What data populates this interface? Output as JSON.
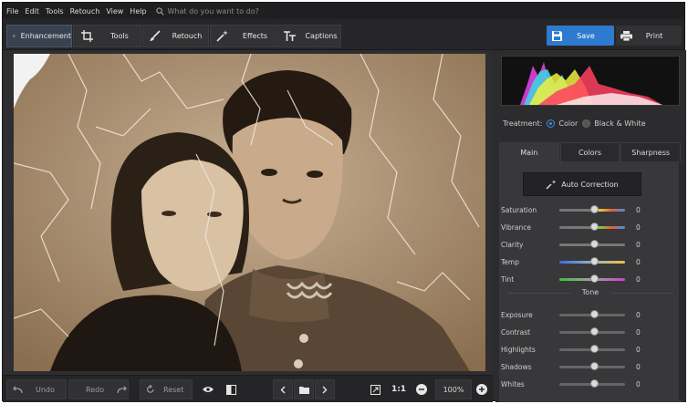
{
  "menu": {
    "items": [
      "File",
      "Edit",
      "Tools",
      "Retouch",
      "View",
      "Help"
    ],
    "search_placeholder": "What do you want to do?"
  },
  "toolbar": {
    "tabs": [
      {
        "label": "Enhancement",
        "icon": "sliders-icon"
      },
      {
        "label": "Tools",
        "icon": "crop-icon"
      },
      {
        "label": "Retouch",
        "icon": "brush-icon"
      },
      {
        "label": "Effects",
        "icon": "magic-wand-icon"
      },
      {
        "label": "Captions",
        "icon": "text-icon"
      }
    ],
    "save_label": "Save",
    "print_label": "Print"
  },
  "bottombar": {
    "undo_label": "Undo",
    "redo_label": "Redo",
    "reset_label": "Reset",
    "ratio_label": "1:1",
    "zoom_value": "100%"
  },
  "panel": {
    "treatment_label": "Treatment:",
    "treatment_options": [
      "Color",
      "Black & White"
    ],
    "treatment_selected": "Color",
    "tabs": [
      "Main",
      "Colors",
      "Sharpness"
    ],
    "active_tab": "Main",
    "auto_correction_label": "Auto Correction",
    "sliders": [
      {
        "name": "Saturation",
        "value": "0"
      },
      {
        "name": "Vibrance",
        "value": "0"
      },
      {
        "name": "Clarity",
        "value": "0"
      },
      {
        "name": "Temp",
        "value": "0"
      },
      {
        "name": "Tint",
        "value": "0"
      }
    ],
    "tone_label": "Tone",
    "tone_sliders": [
      {
        "name": "Exposure",
        "value": "0"
      },
      {
        "name": "Contrast",
        "value": "0"
      },
      {
        "name": "Highlights",
        "value": "0"
      },
      {
        "name": "Shadows",
        "value": "0"
      },
      {
        "name": "Whites",
        "value": "0"
      }
    ]
  },
  "colors": {
    "accent": "#2f7ad1",
    "background": "#2b2b2d"
  }
}
